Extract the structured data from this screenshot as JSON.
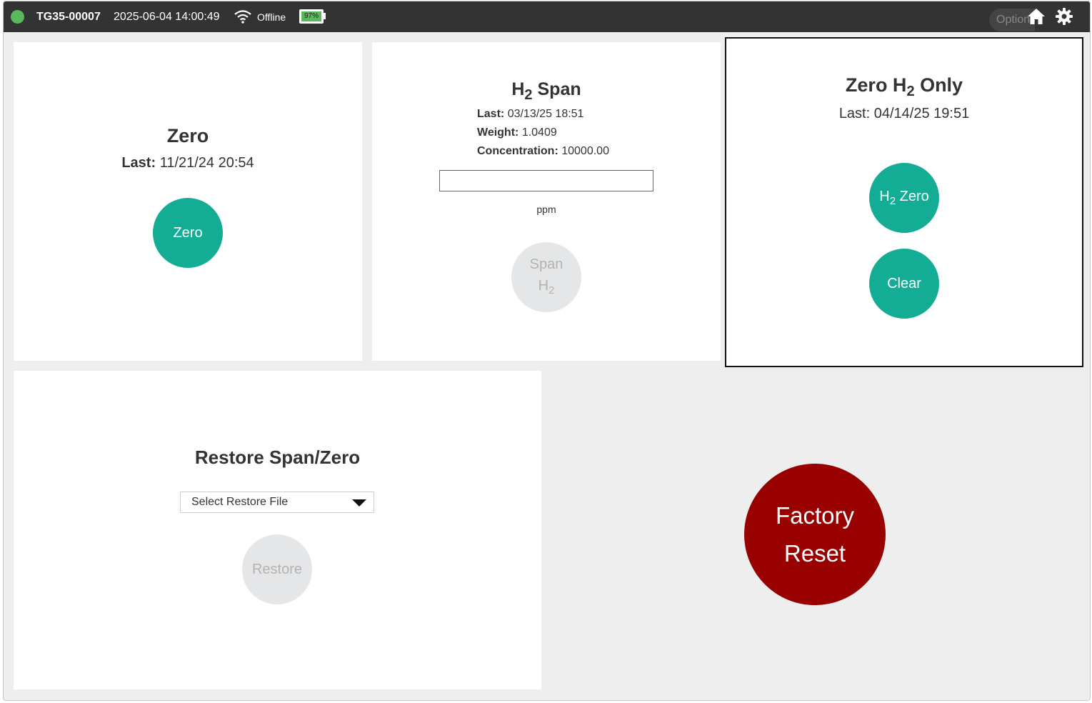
{
  "topbar": {
    "device_id": "TG35-00007",
    "datetime": "2025-06-04 14:00:49",
    "connection": "Offline",
    "battery": "97%",
    "options_label": "Options",
    "icons": [
      "wifi-icon",
      "battery-icon",
      "home-icon",
      "gear-icon"
    ],
    "status_color": "#5cb85c"
  },
  "zero_card": {
    "title": "Zero",
    "last_label": "Last:",
    "last_value": "11/21/24 20:54",
    "button_label": "Zero"
  },
  "span_card": {
    "title_main": "H",
    "title_sub": "2",
    "title_rest": " Span",
    "last_label": "Last:",
    "last_value": "03/13/25 18:51",
    "weight_label": "Weight:",
    "weight_value": "1.0409",
    "concentration_label": "Concentration:",
    "concentration_value": "10000.00",
    "input_value": "",
    "unit": "ppm",
    "button_line1": "Span",
    "button_main": "H",
    "button_sub": "2"
  },
  "zero_h2_card": {
    "title_main": "Zero H",
    "title_sub": "2",
    "title_rest": " Only",
    "last_text": "Last: 04/14/25 19:51",
    "zero_button_main": "H",
    "zero_button_sub": "2",
    "zero_button_rest": " Zero",
    "clear_button": "Clear"
  },
  "restore_card": {
    "title": "Restore Span/Zero",
    "select_value": "Select Restore File",
    "button_label": "Restore"
  },
  "factory_reset": {
    "line1": "Factory",
    "line2": "Reset",
    "color": "#990000"
  },
  "colors": {
    "accent": "#13ad96",
    "disabled": "#e5e6e8",
    "topbar": "#333333"
  }
}
